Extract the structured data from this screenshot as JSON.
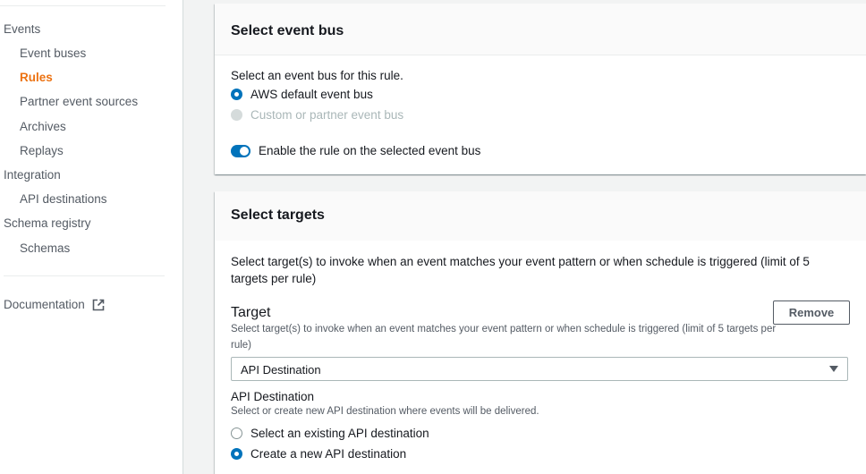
{
  "sidebar": {
    "items": [
      {
        "label": "Events"
      },
      {
        "label": "Event buses"
      },
      {
        "label": "Rules"
      },
      {
        "label": "Partner event sources"
      },
      {
        "label": "Archives"
      },
      {
        "label": "Replays"
      },
      {
        "label": "Integration"
      },
      {
        "label": "API destinations"
      },
      {
        "label": "Schema registry"
      },
      {
        "label": "Schemas"
      }
    ],
    "documentation": "Documentation",
    "active_color": "#ec7211"
  },
  "event_bus": {
    "title": "Select event bus",
    "prompt": "Select an event bus for this rule.",
    "option_default": "AWS default event bus",
    "option_custom": "Custom or partner event bus",
    "selected": "AWS default event bus",
    "toggle_label": "Enable the rule on the selected event bus",
    "toggle_on": true
  },
  "targets": {
    "title": "Select targets",
    "description": "Select target(s) to invoke when an event matches your event pattern or when schedule is triggered (limit of 5 targets per rule)",
    "target_label": "Target",
    "target_desc": "Select target(s) to invoke when an event matches your event pattern or when schedule is triggered (limit of 5 targets per rule)",
    "remove_label": "Remove",
    "select_value": "API Destination",
    "api_dest_label": "API Destination",
    "api_dest_desc": "Select or create new API destination where events will be delivered.",
    "option_existing": "Select an existing API destination",
    "option_new": "Create a new API destination",
    "selected": "Create a new API destination"
  },
  "colors": {
    "accent": "#0073bb",
    "active_nav": "#ec7211"
  }
}
